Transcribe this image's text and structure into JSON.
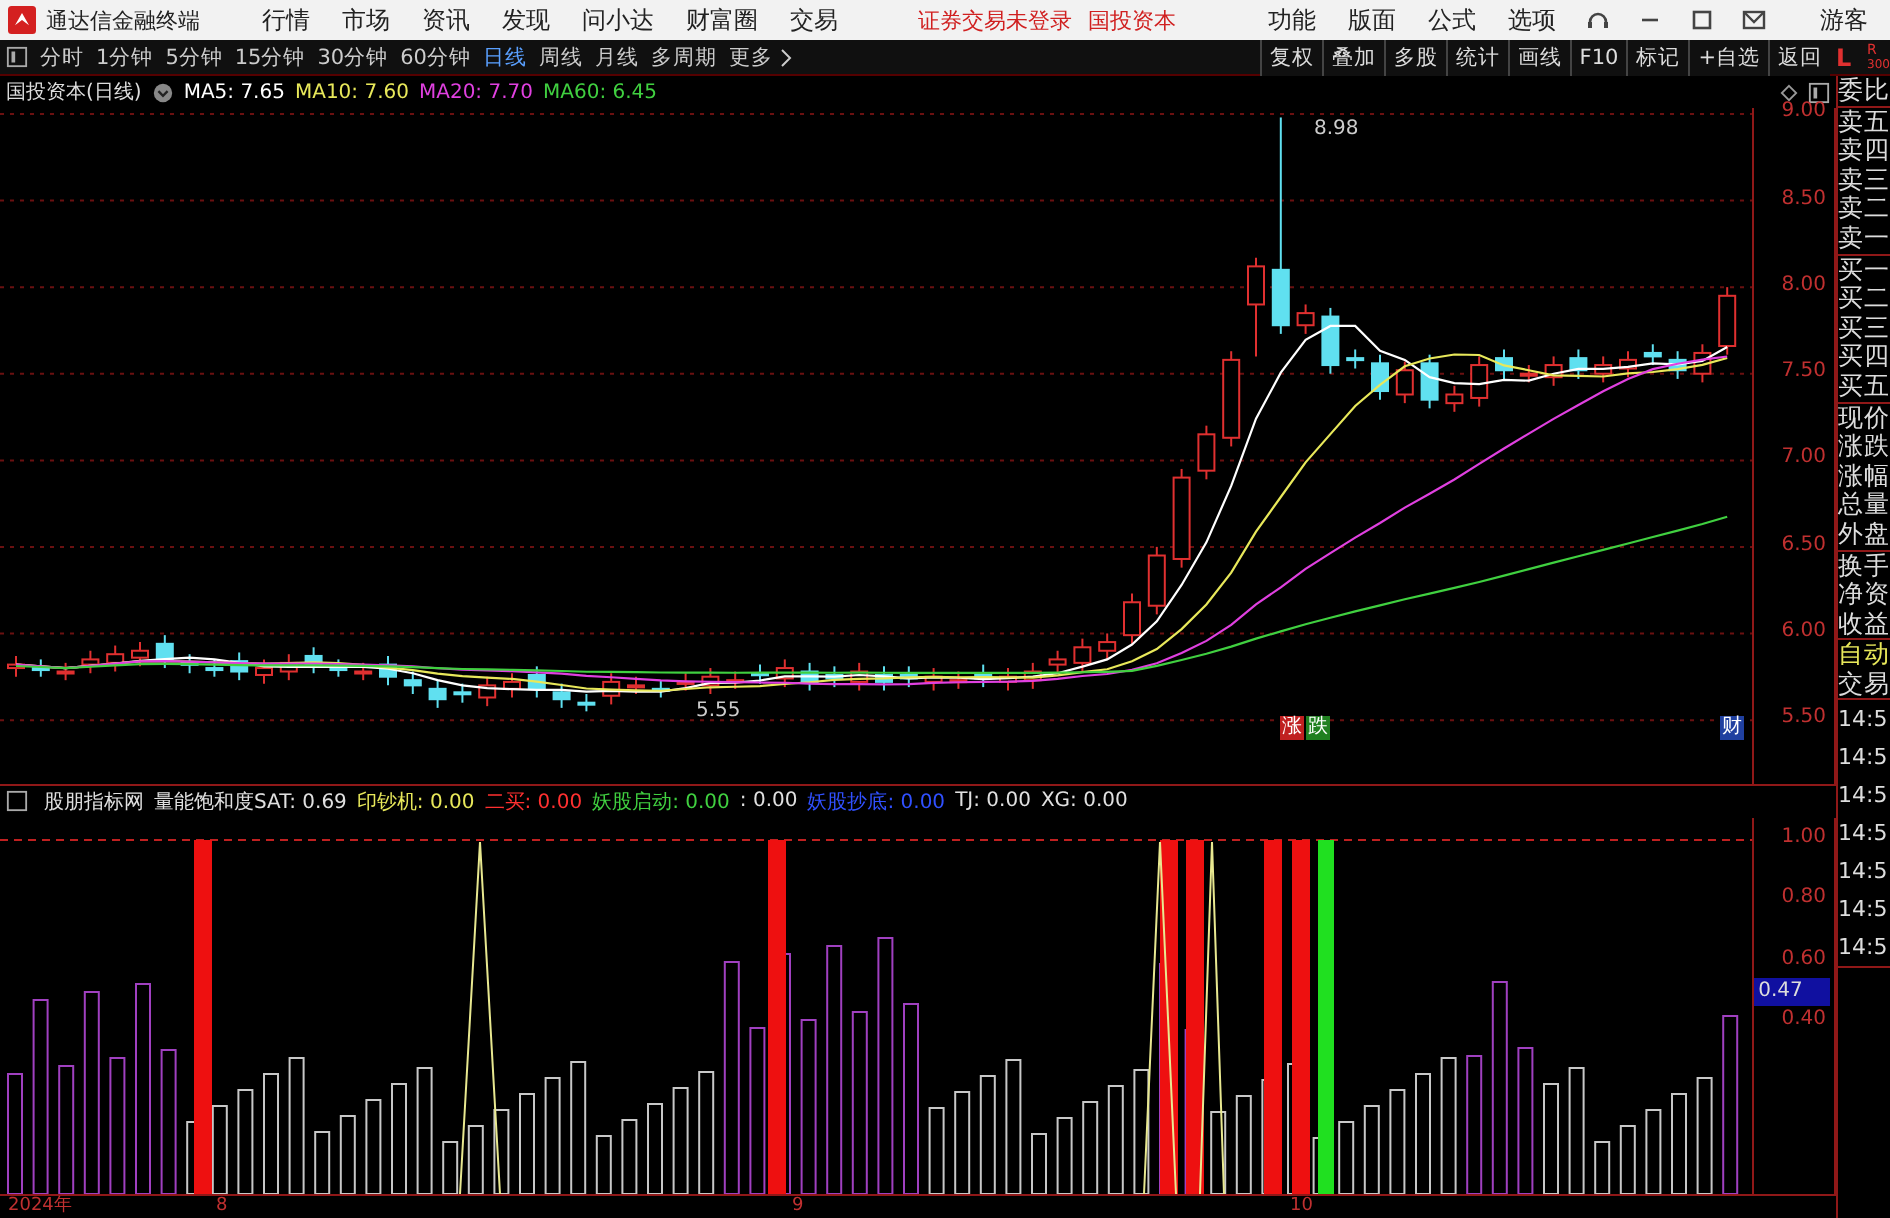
{
  "app": {
    "title": "通达信金融终端"
  },
  "menu": [
    "行情",
    "市场",
    "资讯",
    "发现",
    "问小达",
    "财富圈",
    "交易"
  ],
  "notices": [
    "证券交易未登录",
    "国投资本"
  ],
  "right_menu": [
    "功能",
    "版面",
    "公式",
    "选项"
  ],
  "user": "游客",
  "period_tabs": [
    {
      "label": "分时",
      "selected": false
    },
    {
      "label": "1分钟",
      "selected": false
    },
    {
      "label": "5分钟",
      "selected": false
    },
    {
      "label": "15分钟",
      "selected": false
    },
    {
      "label": "30分钟",
      "selected": false
    },
    {
      "label": "60分钟",
      "selected": false
    },
    {
      "label": "日线",
      "selected": true
    },
    {
      "label": "周线",
      "selected": false
    },
    {
      "label": "月线",
      "selected": false
    },
    {
      "label": "多周期",
      "selected": false
    },
    {
      "label": "更多",
      "selected": false
    }
  ],
  "tools": [
    "复权",
    "叠加",
    "多股",
    "统计",
    "画线",
    "F10",
    "标记",
    "+自选",
    "返回"
  ],
  "corner": {
    "left": "L",
    "right": "R",
    "sub": "300"
  },
  "chart": {
    "title": "国投资本(日线)",
    "mas": [
      {
        "label": "MA5: 7.65",
        "color": "#ffffff"
      },
      {
        "label": "MA10: 7.60",
        "color": "#e8e85a"
      },
      {
        "label": "MA20: 7.70",
        "color": "#e040e0"
      },
      {
        "label": "MA60: 6.45",
        "color": "#40d040"
      }
    ],
    "price_ticks": [
      "9.00",
      "8.50",
      "8.00",
      "7.50",
      "7.00",
      "6.50",
      "6.00",
      "5.50"
    ],
    "high_label": "8.98",
    "low_label": "5.55",
    "badges": [
      {
        "label": "涨",
        "color": "#c02020"
      },
      {
        "label": "跌",
        "color": "#208020"
      },
      {
        "label": "财",
        "color": "#2040a0"
      }
    ]
  },
  "indicator": {
    "fields": [
      {
        "label": "股朋指标网",
        "color": "#e0e0e0"
      },
      {
        "label": "量能饱和度SAT: 0.69",
        "color": "#e0e0e0"
      },
      {
        "label": "印钞机: 0.00",
        "color": "#e8e85a"
      },
      {
        "label": "二买: 0.00",
        "color": "#ff3030"
      },
      {
        "label": "妖股启动: 0.00",
        "color": "#40d040"
      },
      {
        "label": ": 0.00",
        "color": "#e0e0e0"
      },
      {
        "label": "妖股抄底: 0.00",
        "color": "#3050ff"
      },
      {
        "label": "TJ: 0.00",
        "color": "#e0e0e0"
      },
      {
        "label": "XG: 0.00",
        "color": "#e0e0e0"
      }
    ],
    "ticks": [
      "1.00",
      "0.80",
      "0.60",
      "0.40"
    ],
    "current": "0.47"
  },
  "side": {
    "quote_groups": [
      [
        "委比"
      ],
      [
        "卖五",
        "卖四",
        "卖三",
        "卖二",
        "卖一"
      ],
      [
        "买一",
        "买二",
        "买三",
        "买四",
        "买五"
      ],
      [
        "现价",
        "涨跌",
        "涨幅",
        "总量",
        "外盘"
      ],
      [
        "换手",
        "净资",
        "收益"
      ]
    ],
    "trade_labels": [
      "自动",
      "交易"
    ],
    "times": [
      "14:5",
      "14:5",
      "14:5",
      "14:5",
      "14:5",
      "14:5",
      "14:5"
    ]
  },
  "date_axis": [
    "2024年",
    "8",
    "9",
    "10"
  ]
}
